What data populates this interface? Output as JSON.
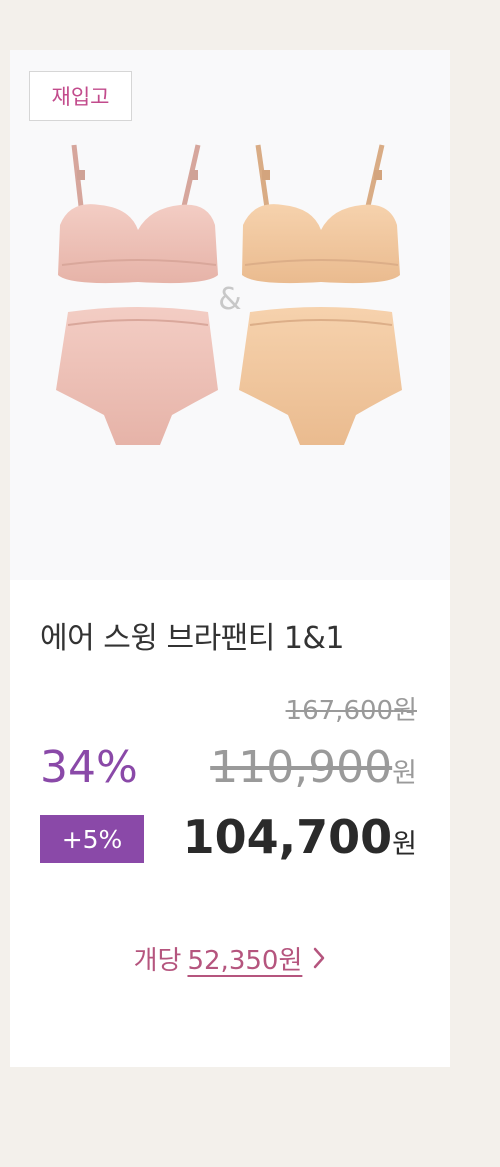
{
  "badge": {
    "label": "재입고"
  },
  "product_image": {
    "ampersand": "&"
  },
  "product": {
    "title": "에어 스윙 브라팬티 1&1"
  },
  "prices": {
    "original": "167,600",
    "discount_percent": "34%",
    "sale": "110,900",
    "extra_discount": "+5%",
    "final": "104,700",
    "unit": "원"
  },
  "per_item": {
    "label": "개당",
    "price": "52,350원"
  },
  "colors": {
    "accent_purple": "#8a49a8",
    "pink_text": "#b5557e",
    "page_bg": "#f3f0eb",
    "pink_set": "#eec2b8",
    "beige_set": "#f2c9a2"
  },
  "icons": {
    "more": "chevron-right-icon"
  }
}
